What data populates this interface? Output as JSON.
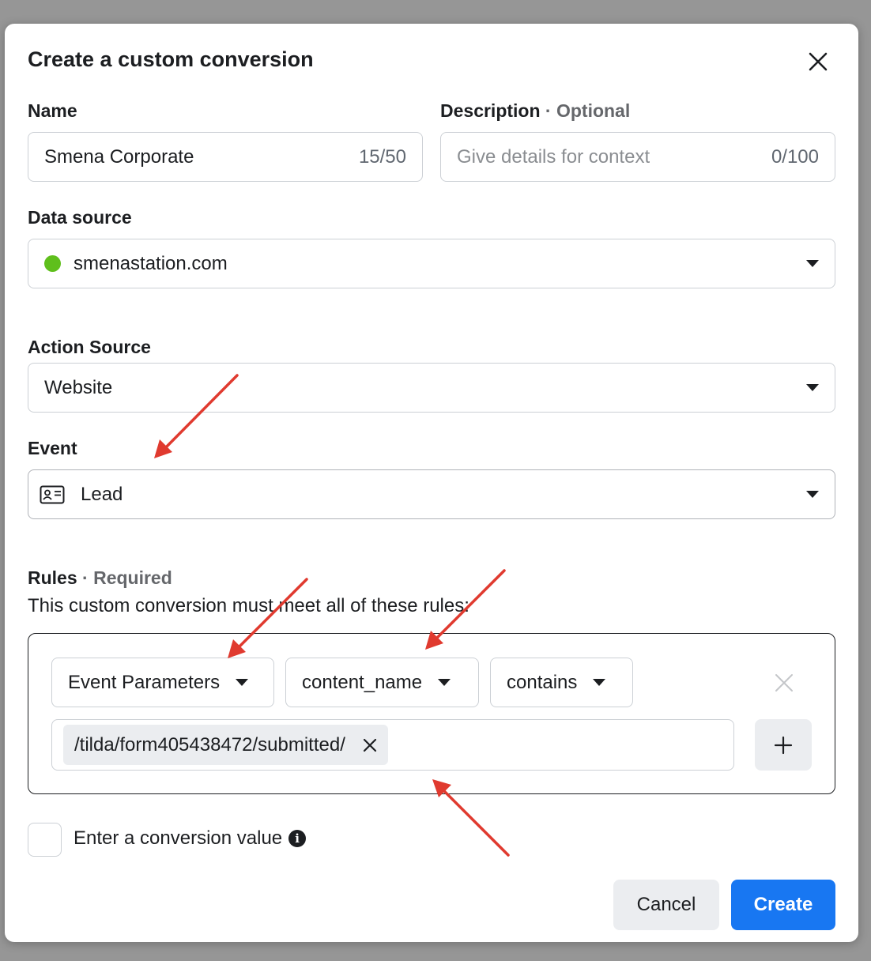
{
  "dialog": {
    "title": "Create a custom conversion"
  },
  "name": {
    "label": "Name",
    "value": "Smena Corporate",
    "counter": "15/50"
  },
  "description": {
    "label": "Description",
    "optional": "· Optional",
    "placeholder": "Give details for context",
    "counter": "0/100"
  },
  "data_source": {
    "label": "Data source",
    "value": "smenastation.com",
    "status_color": "#5fbf1c"
  },
  "action_source": {
    "label": "Action Source",
    "value": "Website"
  },
  "event": {
    "label": "Event",
    "value": "Lead",
    "icon": "contact-card-icon"
  },
  "rules": {
    "label": "Rules",
    "required": "· Required",
    "description": "This custom conversion must meet all of these rules:",
    "rule": {
      "parameter_type": "Event Parameters",
      "parameter": "content_name",
      "operator": "contains",
      "value_token": "/tilda/form405438472/submitted/"
    }
  },
  "conversion_value": {
    "label": "Enter a conversion value",
    "checked": false
  },
  "buttons": {
    "cancel": "Cancel",
    "create": "Create"
  },
  "colors": {
    "primary": "#1877f2",
    "annotation_arrow": "#e03a2f"
  }
}
